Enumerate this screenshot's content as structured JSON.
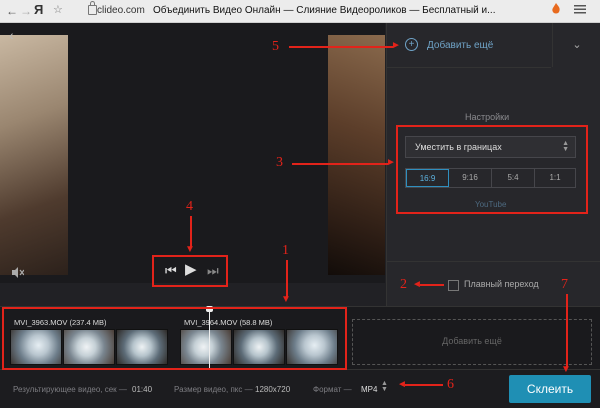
{
  "browser": {
    "back_glyph": "←",
    "forward_glyph": "→",
    "yandex_logo": "Я",
    "bookmark_glyph": "☆",
    "domain": "clideo.com",
    "page_title": "Объединить Видео Онлайн — Слияние Видеороликов — Бесплатный и...",
    "icons": [
      "lock-icon",
      "extension-icon",
      "menu-icon"
    ]
  },
  "editor": {
    "back_glyph": "‹",
    "mute_glyph": "🔇",
    "controls": {
      "prev": "⏮",
      "play": "▶",
      "next": "⏭"
    },
    "add_more_top": "Добавить ещё",
    "chevron": "⌄",
    "settings_title": "Настройки",
    "fit_select": "Уместить в границах",
    "ratios": [
      "16:9",
      "9:16",
      "5:4",
      "1:1"
    ],
    "active_ratio": "16:9",
    "platform_hint": "YouTube",
    "transition_label": "Плавный переход",
    "clips": [
      {
        "name": "MVI_3963.MOV (237.4 MB)"
      },
      {
        "name": "MVI_3964.MOV (58.8 MB)"
      }
    ],
    "add_more_slot": "Добавить ещё",
    "footer": {
      "result_label": "Результирующее видео, сек —",
      "result_value": "01:40",
      "size_label": "Размер видео, пкс —",
      "size_value": "1280x720",
      "format_label": "Формат —",
      "format_value": "MP4",
      "merge_button": "Склеить"
    }
  },
  "annotations": {
    "numbers": [
      "1",
      "2",
      "3",
      "4",
      "5",
      "6",
      "7"
    ],
    "color": "#e2231a"
  },
  "colors": {
    "accent": "#1f8fb4",
    "link": "#6fa3c7",
    "highlight_red": "#e2231a"
  }
}
